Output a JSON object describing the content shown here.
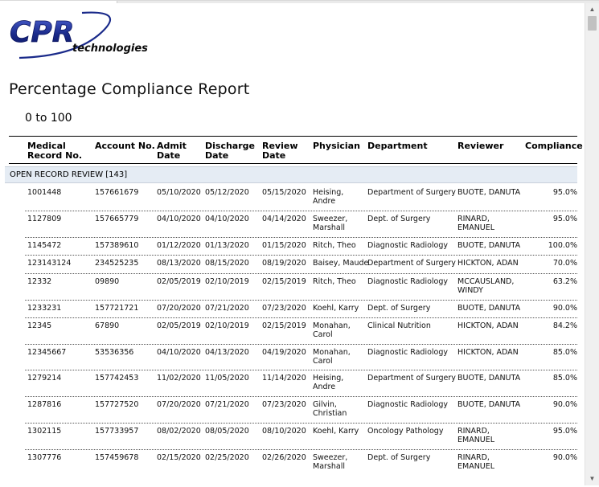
{
  "logo": {
    "main": "CPR",
    "sub": "technologies",
    "colors": {
      "primary": "#1a2a8a",
      "accent": "#0a0a0a"
    }
  },
  "report": {
    "title": "Percentage Compliance Report",
    "range": "0 to 100"
  },
  "columns": [
    {
      "key": "mrn",
      "line1": "Medical",
      "line2": "Record No."
    },
    {
      "key": "account",
      "line1": "Account No.",
      "line2": ""
    },
    {
      "key": "admit",
      "line1": "Admit",
      "line2": "Date"
    },
    {
      "key": "discharge",
      "line1": "Discharge",
      "line2": "Date"
    },
    {
      "key": "review",
      "line1": "Review",
      "line2": "Date"
    },
    {
      "key": "physician",
      "line1": "Physician",
      "line2": ""
    },
    {
      "key": "department",
      "line1": "Department",
      "line2": ""
    },
    {
      "key": "reviewer",
      "line1": "Reviewer",
      "line2": ""
    },
    {
      "key": "compliance",
      "line1": "Compliance",
      "line2": ""
    }
  ],
  "section": {
    "label": "OPEN RECORD REVIEW [143]"
  },
  "rows": [
    {
      "mrn": "1001448",
      "account": "157661679",
      "admit": "05/10/2020",
      "discharge": "05/12/2020",
      "review": "05/15/2020",
      "physician": [
        "Heising,",
        "Andre"
      ],
      "department": "Department of Surgery",
      "reviewer": [
        "BUOTE, DANUTA"
      ],
      "compliance": "95.0%"
    },
    {
      "mrn": "1127809",
      "account": "157665779",
      "admit": "04/10/2020",
      "discharge": "04/10/2020",
      "review": "04/14/2020",
      "physician": [
        "Sweezer,",
        "Marshall"
      ],
      "department": "Dept. of Surgery",
      "reviewer": [
        "RINARD,",
        "EMANUEL"
      ],
      "compliance": "95.0%"
    },
    {
      "mrn": "1145472",
      "account": "157389610",
      "admit": "01/12/2020",
      "discharge": "01/13/2020",
      "review": "01/15/2020",
      "physician": [
        "Ritch, Theo"
      ],
      "department": "Diagnostic Radiology",
      "reviewer": [
        "BUOTE, DANUTA"
      ],
      "compliance": "100.0%"
    },
    {
      "mrn": "123143124",
      "account": "234525235",
      "admit": "08/13/2020",
      "discharge": "08/15/2020",
      "review": "08/19/2020",
      "physician": [
        "Baisey, Maude"
      ],
      "department": "Department of Surgery",
      "reviewer": [
        "HICKTON, ADAN"
      ],
      "compliance": "70.0%"
    },
    {
      "mrn": "12332",
      "account": "09890",
      "admit": "02/05/2019",
      "discharge": "02/10/2019",
      "review": "02/15/2019",
      "physician": [
        "Ritch, Theo"
      ],
      "department": "Diagnostic Radiology",
      "reviewer": [
        "MCCAUSLAND,",
        "WINDY"
      ],
      "compliance": "63.2%"
    },
    {
      "mrn": "1233231",
      "account": "157721721",
      "admit": "07/20/2020",
      "discharge": "07/21/2020",
      "review": "07/23/2020",
      "physician": [
        "Koehl, Karry"
      ],
      "department": "Dept. of Surgery",
      "reviewer": [
        "BUOTE, DANUTA"
      ],
      "compliance": "90.0%"
    },
    {
      "mrn": "12345",
      "account": "67890",
      "admit": "02/05/2019",
      "discharge": "02/10/2019",
      "review": "02/15/2019",
      "physician": [
        "Monahan,",
        "Carol"
      ],
      "department": "Clinical Nutrition",
      "reviewer": [
        "HICKTON, ADAN"
      ],
      "compliance": "84.2%"
    },
    {
      "mrn": "12345667",
      "account": "53536356",
      "admit": "04/10/2020",
      "discharge": "04/13/2020",
      "review": "04/19/2020",
      "physician": [
        "Monahan,",
        "Carol"
      ],
      "department": "Diagnostic Radiology",
      "reviewer": [
        "HICKTON, ADAN"
      ],
      "compliance": "85.0%"
    },
    {
      "mrn": "1279214",
      "account": "157742453",
      "admit": "11/02/2020",
      "discharge": "11/05/2020",
      "review": "11/14/2020",
      "physician": [
        "Heising,",
        "Andre"
      ],
      "department": "Department of Surgery",
      "reviewer": [
        "BUOTE, DANUTA"
      ],
      "compliance": "85.0%"
    },
    {
      "mrn": "1287816",
      "account": "157727520",
      "admit": "07/20/2020",
      "discharge": "07/21/2020",
      "review": "07/23/2020",
      "physician": [
        "Gilvin,",
        "Christian"
      ],
      "department": "Diagnostic Radiology",
      "reviewer": [
        "BUOTE, DANUTA"
      ],
      "compliance": "90.0%"
    },
    {
      "mrn": "1302115",
      "account": "157733957",
      "admit": "08/02/2020",
      "discharge": "08/05/2020",
      "review": "08/10/2020",
      "physician": [
        "Koehl, Karry"
      ],
      "department": "Oncology Pathology",
      "reviewer": [
        "RINARD,",
        "EMANUEL"
      ],
      "compliance": "95.0%"
    },
    {
      "mrn": "1307776",
      "account": "157459678",
      "admit": "02/15/2020",
      "discharge": "02/25/2020",
      "review": "02/26/2020",
      "physician": [
        "Sweezer,",
        "Marshall"
      ],
      "department": "Dept. of Surgery",
      "reviewer": [
        "RINARD,",
        "EMANUEL"
      ],
      "compliance": "90.0%"
    }
  ]
}
